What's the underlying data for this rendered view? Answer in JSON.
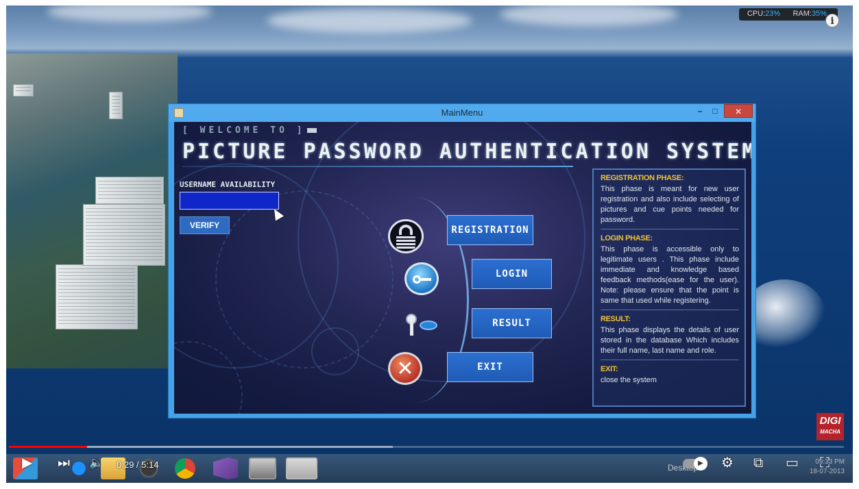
{
  "sysinfo": {
    "cpu_label": "CPU:",
    "cpu_value": "23%",
    "ram_label": "RAM:",
    "ram_value": "35%"
  },
  "window": {
    "title": "MainMenu",
    "min": "–",
    "max": "□",
    "close": "✕"
  },
  "app": {
    "welcome": "[ WELCOME TO ]",
    "title": "PICTURE PASSWORD AUTHENTICATION SYSTEM",
    "username_label": "USERNAME AVAILABILITY",
    "username_value": "",
    "verify_label": "VERIFY"
  },
  "menu": {
    "registration": "REGISTRATION",
    "login": "LOGIN",
    "result": "RESULT",
    "exit": "EXIT"
  },
  "info": {
    "registration_heading": "REGISTRATION PHASE:",
    "registration_text": "This phase is meant for new user registration and also include selecting of pictures and cue points needed for password.",
    "login_heading": "LOGIN PHASE:",
    "login_text": "This phase is accessible only to legitimate users . This phase include immediate and knowledge based feedback methods(ease for the user). Note: please ensure that the point is same that used while registering.",
    "result_heading": "RESULT:",
    "result_text": "This phase displays the details of user stored in the database Which includes their full name, last name and role.",
    "exit_heading": "EXIT:",
    "exit_text": "close the system"
  },
  "brand": {
    "line1": "DIGI",
    "line2": "MACHA"
  },
  "taskbar": {
    "desktop_label": "Desktop",
    "time": "09:33 PM",
    "date": "18-07-2013"
  },
  "player": {
    "time": "0:29 / 5:14",
    "progress_played": 0.094,
    "progress_loaded": 0.46,
    "icons": [
      "play-icon",
      "next-icon",
      "volume-icon",
      "autoplay-icon",
      "settings-icon",
      "miniplayer-icon",
      "theater-icon",
      "fullscreen-icon"
    ]
  }
}
